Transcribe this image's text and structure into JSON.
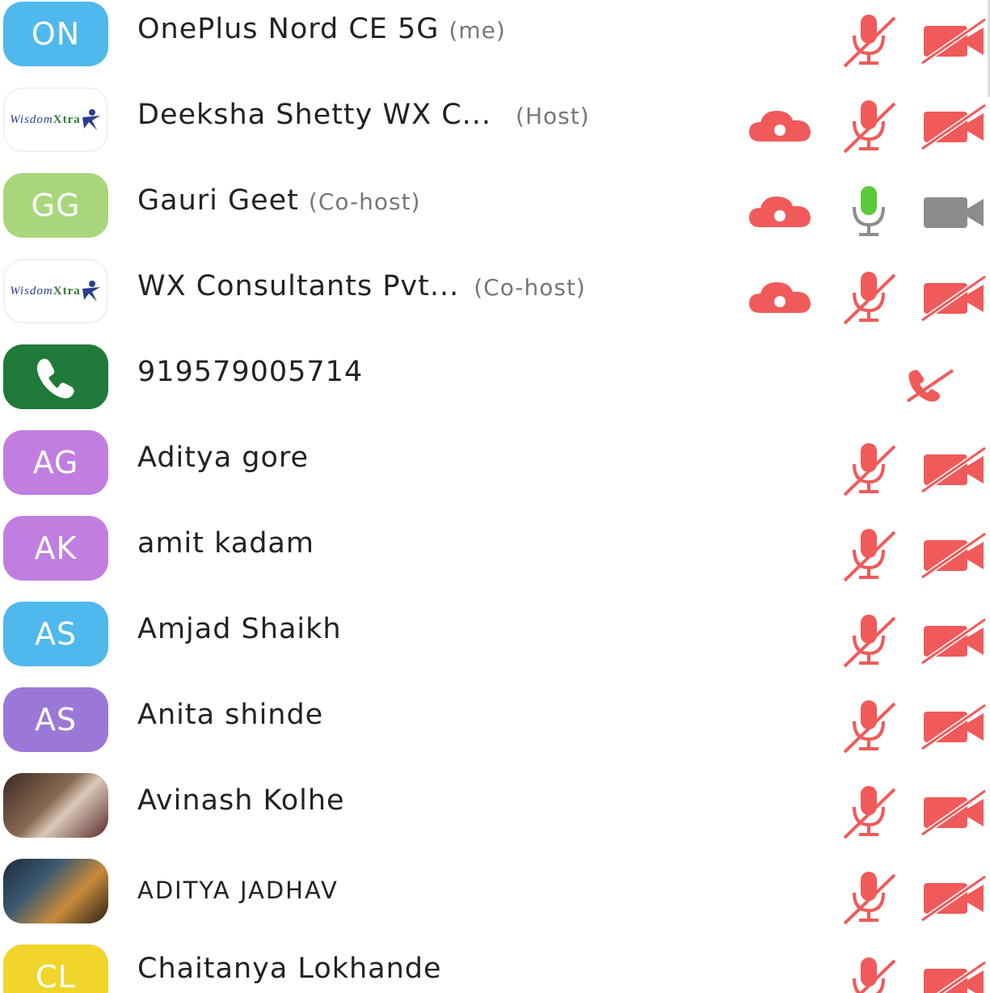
{
  "participants": [
    {
      "avatar_text": "ON",
      "avatar_color": "#4fb8ec",
      "name": "OnePlus Nord CE 5G",
      "role": "(me)",
      "record": false,
      "mic": "muted",
      "camera": "off"
    },
    {
      "avatar_text": "",
      "avatar_type": "wisdomxtra-logo",
      "name": "Deeksha Shetty WX C...",
      "role": "(Host)",
      "record": true,
      "mic": "muted",
      "camera": "off"
    },
    {
      "avatar_text": "GG",
      "avatar_color": "#a9d67a",
      "name": "Gauri Geet",
      "role": "(Co-host)",
      "record": true,
      "mic": "active",
      "camera": "disabled"
    },
    {
      "avatar_text": "",
      "avatar_type": "wisdomxtra-logo",
      "name": "WX Consultants Pvt...",
      "role": "(Co-host)",
      "record": true,
      "mic": "muted",
      "camera": "off"
    },
    {
      "avatar_text": "",
      "avatar_type": "phone-icon",
      "avatar_color": "#1f7a3a",
      "name": "919579005714",
      "role": "",
      "record": false,
      "mic": "phone-muted",
      "camera": "none"
    },
    {
      "avatar_text": "AG",
      "avatar_color": "#c17ee0",
      "name": "Aditya gore",
      "role": "",
      "record": false,
      "mic": "muted",
      "camera": "off"
    },
    {
      "avatar_text": "AK",
      "avatar_color": "#c17ee0",
      "name": "amit kadam",
      "role": "",
      "record": false,
      "mic": "muted",
      "camera": "off"
    },
    {
      "avatar_text": "AS",
      "avatar_color": "#4fb8ec",
      "name": "Amjad Shaikh",
      "role": "",
      "record": false,
      "mic": "muted",
      "camera": "off"
    },
    {
      "avatar_text": "AS",
      "avatar_color": "#9b78d8",
      "name": "Anita shinde",
      "role": "",
      "record": false,
      "mic": "muted",
      "camera": "off"
    },
    {
      "avatar_text": "",
      "avatar_type": "photo",
      "name": "Avinash Kolhe",
      "role": "",
      "record": false,
      "mic": "muted",
      "camera": "off"
    },
    {
      "avatar_text": "",
      "avatar_type": "photo",
      "name": "ADITYA JADHAV",
      "role": "",
      "record": false,
      "mic": "muted",
      "camera": "off"
    },
    {
      "avatar_text": "CL",
      "avatar_color": "#f2d52a",
      "name": "Chaitanya Lokhande",
      "role": "",
      "record": false,
      "mic": "muted",
      "camera": "off"
    }
  ],
  "logo": {
    "line1": "Wisdom",
    "line2": "Xtra"
  },
  "colors": {
    "muted_red": "#f05a5a",
    "mic_active": "#5cc93a",
    "camera_disabled": "#8c8c8c"
  }
}
